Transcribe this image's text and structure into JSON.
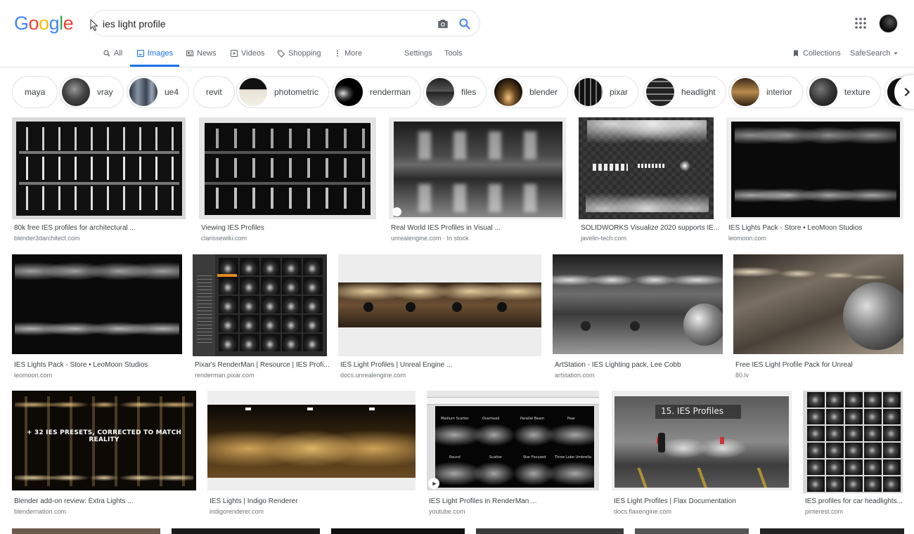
{
  "logo": [
    "G",
    "o",
    "o",
    "g",
    "l",
    "e"
  ],
  "search": {
    "query": "ies light profile"
  },
  "tabs": [
    {
      "label": "All",
      "icon": "search-icon"
    },
    {
      "label": "Images",
      "icon": "image-icon"
    },
    {
      "label": "News",
      "icon": "news-icon"
    },
    {
      "label": "Videos",
      "icon": "video-icon"
    },
    {
      "label": "Shopping",
      "icon": "tag-icon"
    },
    {
      "label": "More",
      "icon": "more-vert-icon"
    },
    {
      "label": "Settings"
    },
    {
      "label": "Tools"
    }
  ],
  "right_tools": {
    "collections": "Collections",
    "safesearch": "SafeSearch"
  },
  "chips": [
    "maya",
    "vray",
    "ue4",
    "revit",
    "photometric",
    "renderman",
    "files",
    "blender",
    "pixar",
    "headlight",
    "interior",
    "texture"
  ],
  "results": [
    {
      "title": "80k free IES profiles for architectural ...",
      "site": "blender3darchitect.com"
    },
    {
      "title": "Viewing IES Profiles",
      "site": "clarissewiki.com"
    },
    {
      "title": "Real World IES Profiles in Visual ...",
      "site": "unrealengine.com · In stock"
    },
    {
      "title": "SOLIDWORKS Visualize 2020 supports IE...",
      "site": "javelin-tech.com"
    },
    {
      "title": "IES Lights Pack - Store • LeoMoon Studios",
      "site": "leomoon.com"
    },
    {
      "title": "IES Lights Pack - Store • LeoMoon Studios",
      "site": "leomoon.com"
    },
    {
      "title": "Pixar's RenderMan | Resource | IES Profi...",
      "site": "renderman.pixar.com"
    },
    {
      "title": "IES Light Profiles | Unreal Engine ...",
      "site": "docs.unrealengine.com"
    },
    {
      "title": "ArtStation - IES Lighting pack, Lee Cobb",
      "site": "artstation.com"
    },
    {
      "title": "Free IES Light Profile Pack for Unreal",
      "site": "80.lv"
    },
    {
      "title": "Blender add-on review: Extra Lights ...",
      "site": "blendernation.com"
    },
    {
      "title": "IES Lights | Indigo Renderer",
      "site": "indigorenderer.com"
    },
    {
      "title": "IES Light Profiles in RenderMan ...",
      "site": "youtube.com"
    },
    {
      "title": "IES Light Profiles | Flax Documentation",
      "site": "docs.flaxengine.com"
    },
    {
      "title": "IES profiles for car headlights...",
      "site": "pinterest.com"
    }
  ],
  "image_text": {
    "blender_overlay": "+ 32 IES PRESETS, CORRECTED TO MATCH REALITY",
    "flax_heading": "15. IES Profiles",
    "rm_labels": [
      "Medium Scatter",
      "Overhead",
      "Parallel Beam",
      "Pear",
      "Round",
      "Scatter",
      "Star Focused",
      "Three Lobe Umbrella"
    ]
  }
}
